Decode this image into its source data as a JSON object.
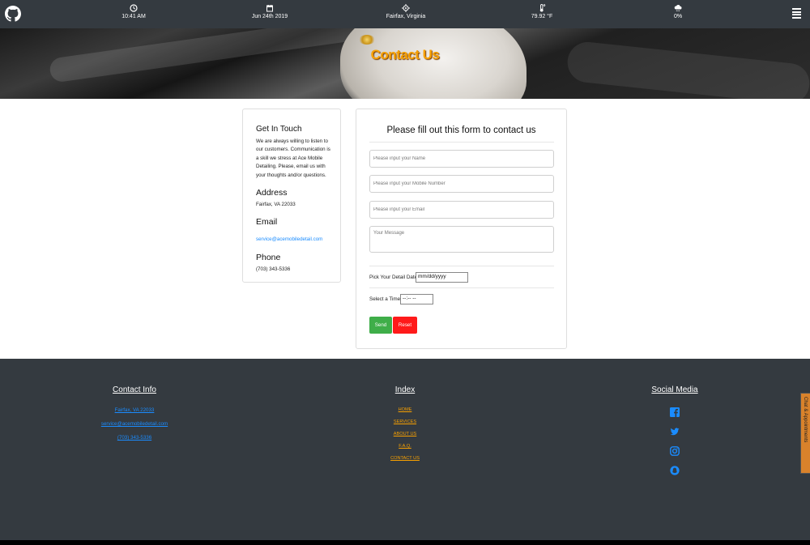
{
  "topbar": {
    "time": "10:41 AM",
    "date": "Jun 24th 2019",
    "location": "Fairfax, Virginia",
    "temperature": "79.92 °F",
    "precipitation": "0%"
  },
  "hero": {
    "title": "Contact Us"
  },
  "info": {
    "heading": "Get In Touch",
    "text": "We are always willing to listen to our customers. Communication is a skill we stress at Ace Mobile Detailing. Please, email us with your thoughts and/or questions.",
    "address_heading": "Address",
    "address": "Fairfax, VA 22033",
    "email_heading": "Email",
    "email": "service@acemobiledetail.com",
    "phone_heading": "Phone",
    "phone": "(703) 343-5336"
  },
  "form": {
    "title": "Please fill out this form to contact us",
    "name_placeholder": "Please input your Name",
    "mobile_placeholder": "Please input your Mobile Number",
    "email_placeholder": "Please input your Email",
    "message_placeholder": "Your Message",
    "date_label": "Pick Your Detail Date:",
    "date_value": "mm/dd/yyyy",
    "time_label": "Select a Time:",
    "time_value": "--:-- --",
    "send_label": "Send",
    "reset_label": "Reset"
  },
  "footer": {
    "contact_heading": "Contact Info",
    "contact_address": "Fairfax, VA 22033",
    "contact_email": "service@acemobiledetail.com",
    "contact_phone": "(703) 343-5336",
    "index_heading": "Index",
    "index_items": [
      "HOME",
      "SERVICES",
      "ABOUT US",
      "F.A.Q.",
      "CONTACT US"
    ],
    "social_heading": "Social Media",
    "social_icons": [
      "facebook-icon",
      "twitter-icon",
      "instagram-icon",
      "snapchat-icon"
    ]
  },
  "side_tab": {
    "label": "Chat & Appointments"
  },
  "colors": {
    "accent": "#f7a000",
    "link": "#1a8cff",
    "send": "#3fae49",
    "reset": "#ff1a1a",
    "dark": "#343a40"
  }
}
